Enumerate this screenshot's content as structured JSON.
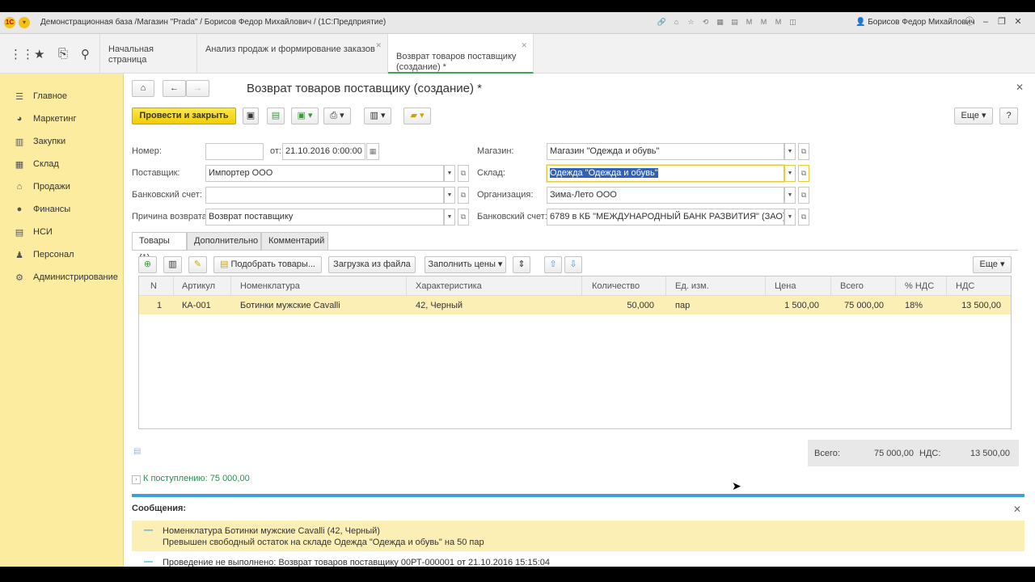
{
  "window": {
    "title": "Демонстрационная база /Магазин \"Prada\" / Борисов Федор Михайлович /  (1С:Предприятие)",
    "user": "Борисов Федор Михайлович"
  },
  "open_tabs": [
    {
      "label": "Начальная страница"
    },
    {
      "label": "Анализ продаж и формирование заказов"
    },
    {
      "label": "Возврат товаров поставщику\n(создание) *"
    }
  ],
  "sidebar": {
    "items": [
      {
        "label": "Главное",
        "icon": "menu-lines-icon"
      },
      {
        "label": "Маркетинг",
        "icon": "pie-chart-icon"
      },
      {
        "label": "Закупки",
        "icon": "purchases-icon"
      },
      {
        "label": "Склад",
        "icon": "warehouse-icon"
      },
      {
        "label": "Продажи",
        "icon": "sales-icon"
      },
      {
        "label": "Финансы",
        "icon": "coin-icon"
      },
      {
        "label": "НСИ",
        "icon": "catalog-icon"
      },
      {
        "label": "Персонал",
        "icon": "person-icon"
      },
      {
        "label": "Администрирование",
        "icon": "gear-icon"
      }
    ]
  },
  "form": {
    "title": "Возврат товаров поставщику (создание) *",
    "post_and_close": "Провести и закрыть",
    "more": "Еще",
    "help": "?",
    "labels": {
      "number": "Номер:",
      "from": "от:",
      "supplier": "Поставщик:",
      "bank_account": "Банковский счет:",
      "return_reason": "Причина возврата:",
      "store": "Магазин:",
      "warehouse": "Склад:",
      "organization": "Организация:",
      "org_bank_account": "Банковский счет:"
    },
    "values": {
      "number": "",
      "date": "21.10.2016  0:00:00",
      "supplier": "Импортер ООО",
      "bank_account": "",
      "return_reason": "Возврат поставщику",
      "store": "Магазин \"Одежда и обувь\"",
      "warehouse": "Одежда \"Одежда и обувь\"",
      "organization": "Зима-Лето ООО",
      "org_bank_account": "6789 в КБ \"МЕЖДУНАРОДНЫЙ БАНК РАЗВИТИЯ\" (ЗАО)"
    }
  },
  "page_tabs": [
    {
      "label": "Товары (1)"
    },
    {
      "label": "Дополнительно"
    },
    {
      "label": "Комментарий"
    }
  ],
  "table_toolbar": {
    "pick_goods": "Подобрать товары...",
    "load_from_file": "Загрузка из файла",
    "fill_prices": "Заполнить цены",
    "more": "Еще"
  },
  "table": {
    "columns": [
      "N",
      "Артикул",
      "Номенклатура",
      "Характеристика",
      "Количество",
      "Ед. изм.",
      "Цена",
      "Всего",
      "% НДС",
      "НДС"
    ],
    "rows": [
      {
        "n": "1",
        "article": "КА-001",
        "item": "Ботинки мужские Cavalli",
        "characteristic": "42, Черный",
        "qty": "50,000",
        "unit": "пар",
        "price": "1 500,00",
        "total": "75 000,00",
        "vat_rate": "18%",
        "vat": "13 500,00"
      }
    ]
  },
  "totals": {
    "total_label": "Всего:",
    "total_value": "75 000,00",
    "vat_label": "НДС:",
    "vat_value": "13 500,00"
  },
  "to_receipt": "К поступлению: 75 000,00",
  "messages": {
    "title": "Сообщения:",
    "items": [
      {
        "line1": "Номенклатура Ботинки мужские Cavalli (42, Черный)",
        "line2": "Превышен свободный остаток на складе Одежда \"Одежда и обувь\" на 50 пар"
      },
      {
        "line1": "Проведение не выполнено: Возврат товаров поставщику 00РТ-000001 от 21.10.2016 15:15:04"
      }
    ]
  },
  "colors": {
    "accent_yellow": "#f2cc07",
    "sidebar_bg": "#fbeca0",
    "selected_row": "#fbefb5",
    "messages_bar": "#3f9fd6",
    "active_tab_underline": "#41a355"
  }
}
